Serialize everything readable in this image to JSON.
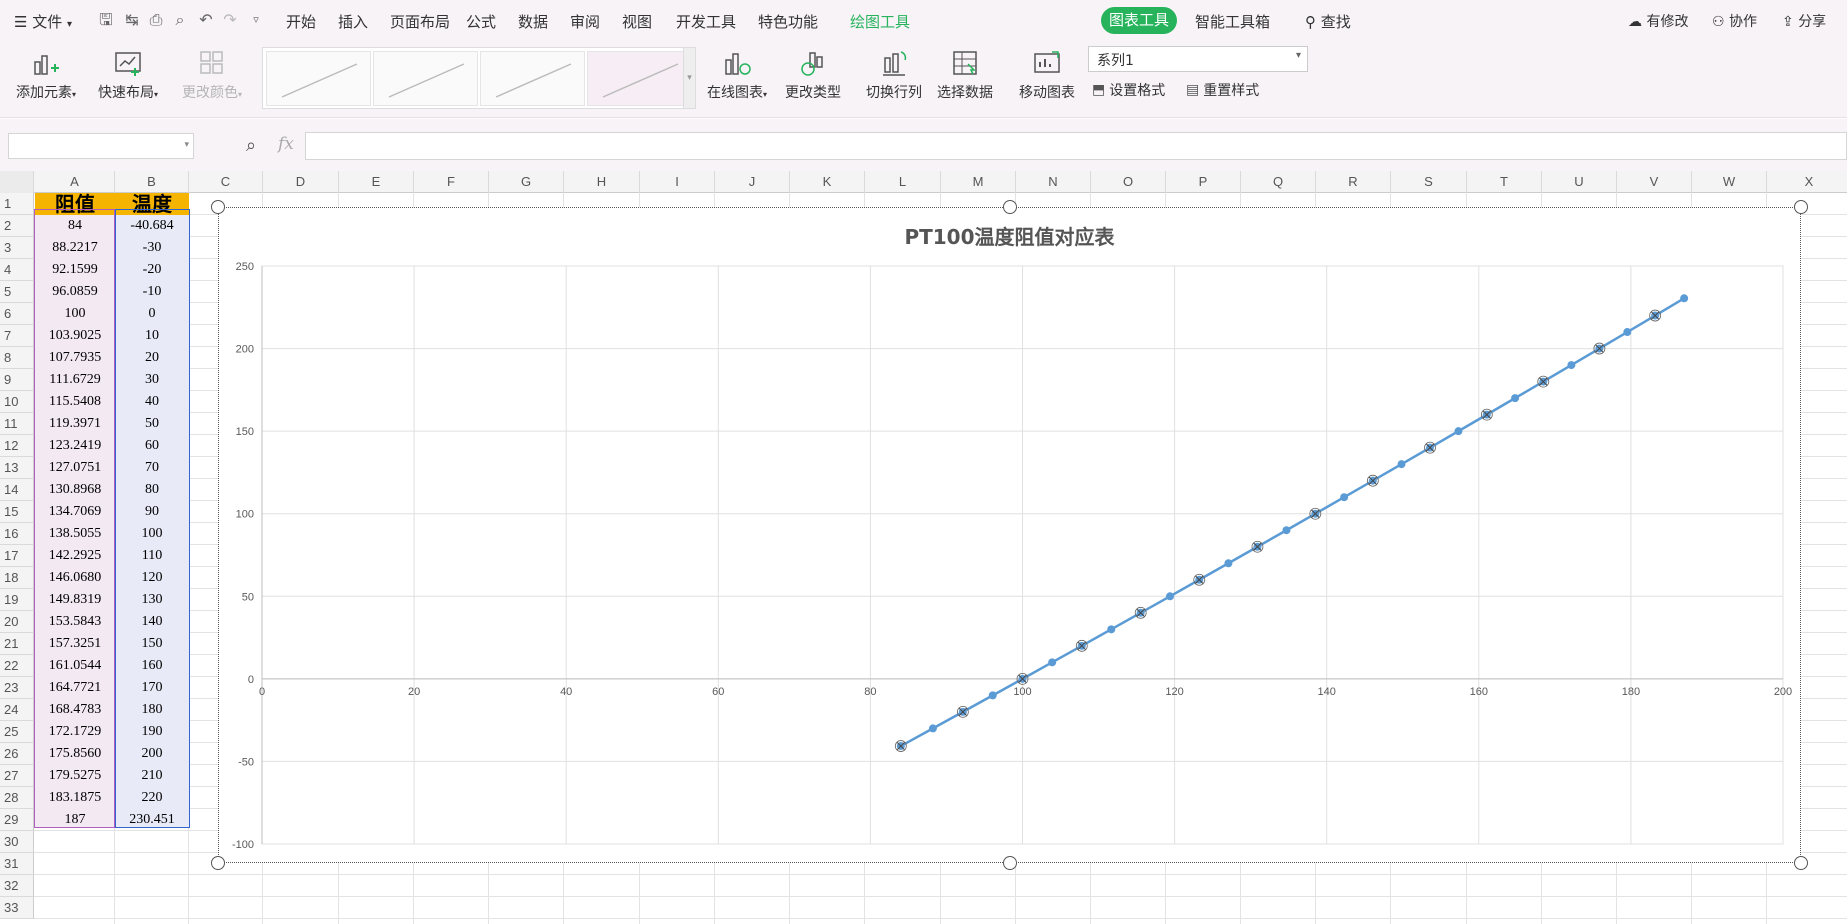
{
  "menubar": {
    "file_label": "文件",
    "tabs": [
      "开始",
      "插入",
      "页面布局",
      "公式",
      "数据",
      "审阅",
      "视图",
      "开发工具",
      "特色功能"
    ],
    "drawing_tools": "绘图工具",
    "chart_tools": "图表工具",
    "smart_toolbox": "智能工具箱",
    "search": "查找",
    "modified": "有修改",
    "collaborate": "协作",
    "share": "分享",
    "accent_color": "#26b35c"
  },
  "ribbon": {
    "add_element": "添加元素",
    "quick_layout": "快速布局",
    "change_color": "更改颜色",
    "online_chart": "在线图表",
    "change_type": "更改类型",
    "switch_rowcol": "切换行列",
    "select_data": "选择数据",
    "move_chart": "移动图表",
    "series_select": "系列1",
    "set_format": "设置格式",
    "reset_style": "重置样式"
  },
  "formula": {
    "fx": "fx",
    "name_value": "",
    "formula_value": ""
  },
  "sheet": {
    "columns": [
      "A",
      "B",
      "C",
      "D",
      "E",
      "F",
      "G",
      "H",
      "I",
      "J",
      "K",
      "L",
      "M",
      "N",
      "O",
      "P",
      "Q",
      "R",
      "S",
      "T",
      "U",
      "V",
      "W",
      "X"
    ],
    "rows": [
      "1",
      "2",
      "3",
      "4",
      "5",
      "6",
      "7",
      "8",
      "9",
      "10",
      "11",
      "12",
      "13",
      "14",
      "15",
      "16",
      "17",
      "18",
      "19",
      "20",
      "21",
      "22",
      "23",
      "24",
      "25",
      "26",
      "27",
      "28",
      "29",
      "30",
      "31",
      "32",
      "33"
    ],
    "header_A": "阻值",
    "header_B": "温度",
    "header_color": "#f4b400",
    "colA": [
      "84",
      "88.2217",
      "92.1599",
      "96.0859",
      "100",
      "103.9025",
      "107.7935",
      "111.6729",
      "115.5408",
      "119.3971",
      "123.2419",
      "127.0751",
      "130.8968",
      "134.7069",
      "138.5055",
      "142.2925",
      "146.0680",
      "149.8319",
      "153.5843",
      "157.3251",
      "161.0544",
      "164.7721",
      "168.4783",
      "172.1729",
      "175.8560",
      "179.5275",
      "183.1875",
      "187"
    ],
    "colB": [
      "-40.684",
      "-30",
      "-20",
      "-10",
      "0",
      "10",
      "20",
      "30",
      "40",
      "50",
      "60",
      "70",
      "80",
      "90",
      "100",
      "110",
      "120",
      "130",
      "140",
      "150",
      "160",
      "170",
      "180",
      "190",
      "200",
      "210",
      "220",
      "230.451"
    ]
  },
  "chart_data": {
    "type": "scatter",
    "title": "PT100温度阻值对应表",
    "xlabel": "",
    "ylabel": "",
    "xlim": [
      0,
      200
    ],
    "ylim": [
      -100,
      250
    ],
    "x_ticks": [
      "0",
      "20",
      "40",
      "60",
      "80",
      "100",
      "120",
      "140",
      "160",
      "180",
      "200"
    ],
    "y_ticks": [
      "250",
      "200",
      "150",
      "100",
      "50",
      "0",
      "-50",
      "-100"
    ],
    "grid": true,
    "series": [
      {
        "color": "#5b9bd5",
        "x": [
          84,
          88.2217,
          92.1599,
          96.0859,
          100,
          103.9025,
          107.7935,
          111.6729,
          115.5408,
          119.3971,
          123.2419,
          127.0751,
          130.8968,
          134.7069,
          138.5055,
          142.2925,
          146.068,
          149.8319,
          153.5843,
          157.3251,
          161.0544,
          164.7721,
          168.4783,
          172.1729,
          175.856,
          179.5275,
          183.1875,
          187
        ],
        "y": [
          -40.684,
          -30,
          -20,
          -10,
          0,
          10,
          20,
          30,
          40,
          50,
          60,
          70,
          80,
          90,
          100,
          110,
          120,
          130,
          140,
          150,
          160,
          170,
          180,
          190,
          200,
          210,
          220,
          230.451
        ]
      }
    ]
  }
}
